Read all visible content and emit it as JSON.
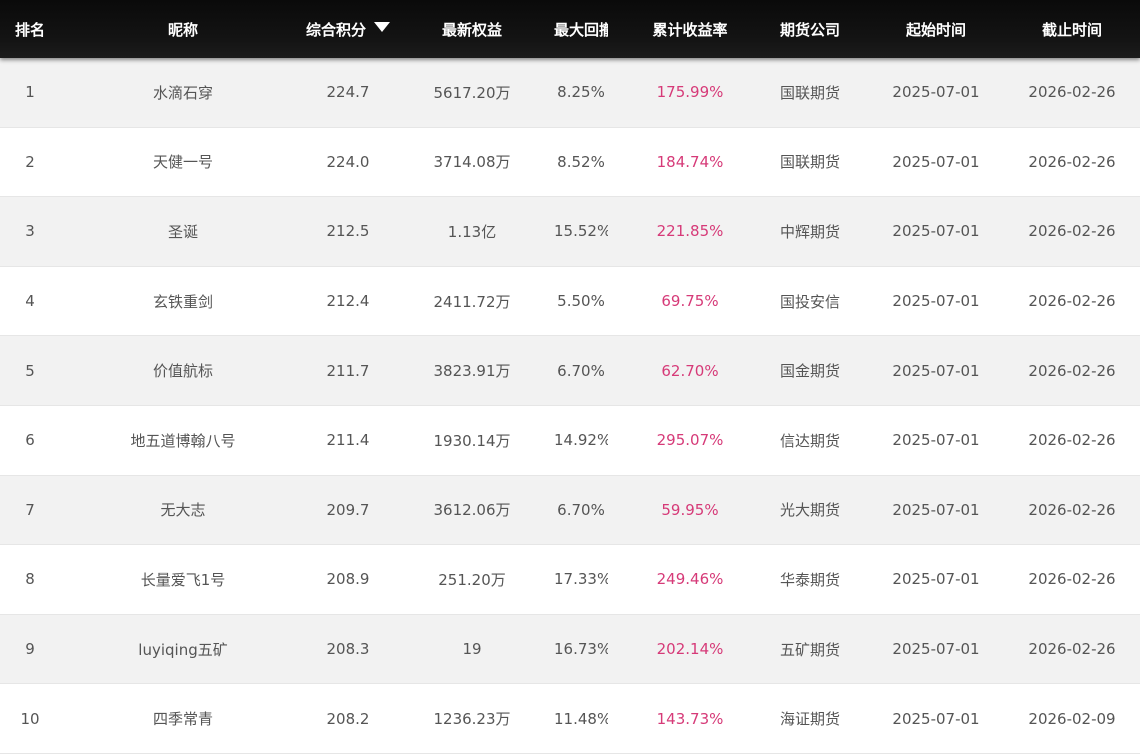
{
  "header": {
    "rank": "排名",
    "name": "昵称",
    "score": "综合积分",
    "equity": "最新权益",
    "drawdown": "最大回撤",
    "return": "累计收益率",
    "company": "期货公司",
    "start": "起始时间",
    "end": "截止时间"
  },
  "colors": {
    "header_bg": "#111111",
    "return_text": "#d63a78",
    "row_alt": "#f2f2f2"
  },
  "rows": [
    {
      "rank": "1",
      "name": "水滴石穿",
      "score": "224.7",
      "equity": "5617.20万",
      "drawdown": "8.25%",
      "return": "175.99%",
      "company": "国联期货",
      "start": "2025-07-01",
      "end": "2026-02-26"
    },
    {
      "rank": "2",
      "name": "天健一号",
      "score": "224.0",
      "equity": "3714.08万",
      "drawdown": "8.52%",
      "return": "184.74%",
      "company": "国联期货",
      "start": "2025-07-01",
      "end": "2026-02-26"
    },
    {
      "rank": "3",
      "name": "圣诞",
      "score": "212.5",
      "equity": "1.13亿",
      "drawdown": "15.52%",
      "return": "221.85%",
      "company": "中辉期货",
      "start": "2025-07-01",
      "end": "2026-02-26"
    },
    {
      "rank": "4",
      "name": "玄铁重剑",
      "score": "212.4",
      "equity": "2411.72万",
      "drawdown": "5.50%",
      "return": "69.75%",
      "company": "国投安信",
      "start": "2025-07-01",
      "end": "2026-02-26"
    },
    {
      "rank": "5",
      "name": "价值航标",
      "score": "211.7",
      "equity": "3823.91万",
      "drawdown": "6.70%",
      "return": "62.70%",
      "company": "国金期货",
      "start": "2025-07-01",
      "end": "2026-02-26"
    },
    {
      "rank": "6",
      "name": "地五道博翰八号",
      "score": "211.4",
      "equity": "1930.14万",
      "drawdown": "14.92%",
      "return": "295.07%",
      "company": "信达期货",
      "start": "2025-07-01",
      "end": "2026-02-26"
    },
    {
      "rank": "7",
      "name": "无大志",
      "score": "209.7",
      "equity": "3612.06万",
      "drawdown": "6.70%",
      "return": "59.95%",
      "company": "光大期货",
      "start": "2025-07-01",
      "end": "2026-02-26"
    },
    {
      "rank": "8",
      "name": "长量爱飞1号",
      "score": "208.9",
      "equity": "251.20万",
      "drawdown": "17.33%",
      "return": "249.46%",
      "company": "华泰期货",
      "start": "2025-07-01",
      "end": "2026-02-26"
    },
    {
      "rank": "9",
      "name": "luyiqing五矿",
      "score": "208.3",
      "equity": "19",
      "drawdown": "16.73%",
      "return": "202.14%",
      "company": "五矿期货",
      "start": "2025-07-01",
      "end": "2026-02-26"
    },
    {
      "rank": "10",
      "name": "四季常青",
      "score": "208.2",
      "equity": "1236.23万",
      "drawdown": "11.48%",
      "return": "143.73%",
      "company": "海证期货",
      "start": "2025-07-01",
      "end": "2026-02-09"
    }
  ]
}
